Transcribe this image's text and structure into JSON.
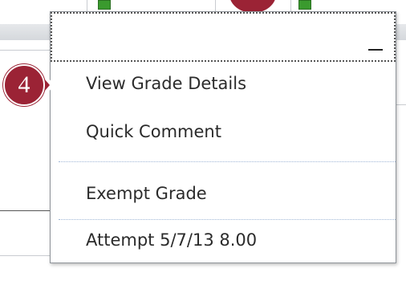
{
  "step": {
    "number": "4"
  },
  "menu": {
    "items": [
      {
        "label": "View Grade Details"
      },
      {
        "label": "Quick Comment"
      },
      {
        "label": "Exempt Grade"
      },
      {
        "label": "Attempt 5/7/13 8.00"
      }
    ]
  },
  "colors": {
    "callout": "#9b2335",
    "status_green": "#3a9a2e",
    "divider": "#9fb6d6"
  }
}
